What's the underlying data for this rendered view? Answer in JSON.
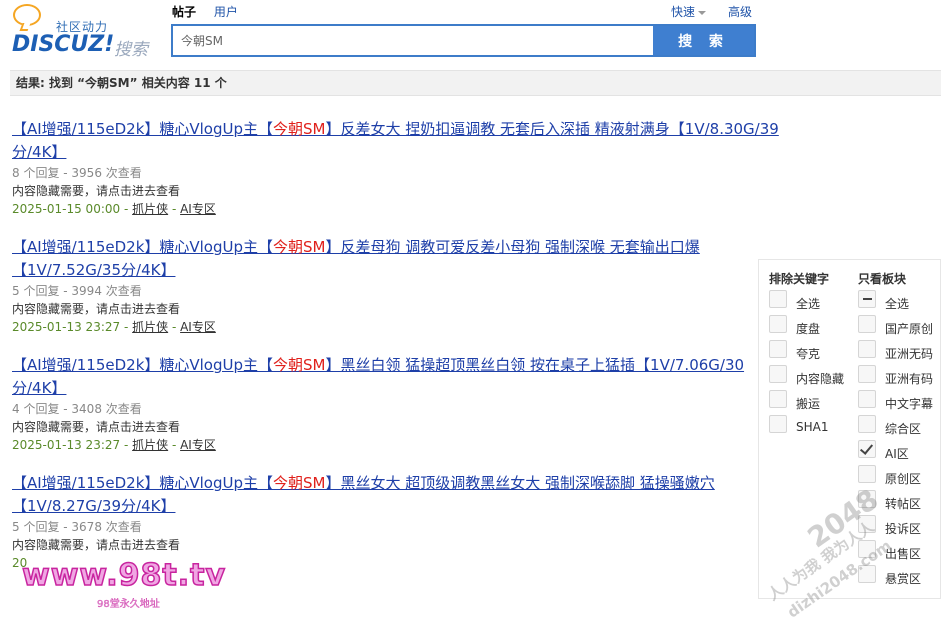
{
  "logo": {
    "tagline": "社区动力",
    "brand": "DISCUZ!",
    "sub": "搜索"
  },
  "header": {
    "tabs": [
      {
        "label": "帖子",
        "active": true
      },
      {
        "label": "用户",
        "active": false
      }
    ],
    "quick_label": "快速",
    "advanced_label": "高级"
  },
  "search": {
    "value": "今朝SM",
    "button_label": "搜 索"
  },
  "summary": "结果: 找到 “今朝SM” 相关内容 11 个",
  "results": [
    {
      "title_pre": "【AI增强/115eD2k】糖心VlogUp主【",
      "title_hl": "今朝SM",
      "title_post": "】反差女大 捏奶扣逼调教 无套后入深插 精液射满身【1V/8.30G/39分/4K】",
      "stats": "8 个回复 - 3956 次查看",
      "desc": "内容隐藏需要，请点击进去查看",
      "date": "2025-01-15 00:00",
      "author": "抓片侠",
      "forum": "AI专区"
    },
    {
      "title_pre": "【AI增强/115eD2k】糖心VlogUp主【",
      "title_hl": "今朝SM",
      "title_post": "】反差母狗 调教可爱反差小母狗 强制深喉 无套输出口爆【1V/7.52G/35分/4K】",
      "stats": "5 个回复 - 3994 次查看",
      "desc": "内容隐藏需要，请点击进去查看",
      "date": "2025-01-13 23:27",
      "author": "抓片侠",
      "forum": "AI专区"
    },
    {
      "title_pre": "【AI增强/115eD2k】糖心VlogUp主【",
      "title_hl": "今朝SM",
      "title_post": "】黑丝白领 猛操超顶黑丝白领 按在桌子上猛插【1V/7.06G/30分/4K】",
      "stats": "4 个回复 - 3408 次查看",
      "desc": "内容隐藏需要，请点击进去查看",
      "date": "2025-01-13 23:27",
      "author": "抓片侠",
      "forum": "AI专区"
    },
    {
      "title_pre": "【AI增强/115eD2k】糖心VlogUp主【",
      "title_hl": "今朝SM",
      "title_post": "】黑丝女大 超顶级调教黑丝女大 强制深喉舔脚 猛操骚嫩穴【1V/8.27G/39分/4K】",
      "stats": "5 个回复 - 3678 次查看",
      "desc": "内容隐藏需要，请点击进去查看",
      "date": "20",
      "author": "",
      "forum": ""
    }
  ],
  "filter": {
    "exclude_title": "排除关键字",
    "exclude": [
      {
        "label": "全选",
        "state": "off"
      },
      {
        "label": "度盘",
        "state": "off"
      },
      {
        "label": "夸克",
        "state": "off"
      },
      {
        "label": "内容隐藏",
        "state": "off"
      },
      {
        "label": "搬运",
        "state": "off"
      },
      {
        "label": "SHA1",
        "state": "off"
      }
    ],
    "only_title": "只看板块",
    "only": [
      {
        "label": "全选",
        "state": "partial"
      },
      {
        "label": "国产原创",
        "state": "off"
      },
      {
        "label": "亚洲无码",
        "state": "off"
      },
      {
        "label": "亚洲有码",
        "state": "off"
      },
      {
        "label": "中文字幕",
        "state": "off"
      },
      {
        "label": "综合区",
        "state": "off"
      },
      {
        "label": "AI区",
        "state": "on"
      },
      {
        "label": "原创区",
        "state": "off"
      },
      {
        "label": "转帖区",
        "state": "off"
      },
      {
        "label": "投诉区",
        "state": "off"
      },
      {
        "label": "出售区",
        "state": "off"
      },
      {
        "label": "悬赏区",
        "state": "off"
      }
    ]
  },
  "watermarks": {
    "site": "www.98t.tv",
    "site_sub": "98堂永久地址",
    "right_big": "2048",
    "right_line1": "人人为我 我为人人",
    "right_line2": "dizhi2048.com"
  }
}
